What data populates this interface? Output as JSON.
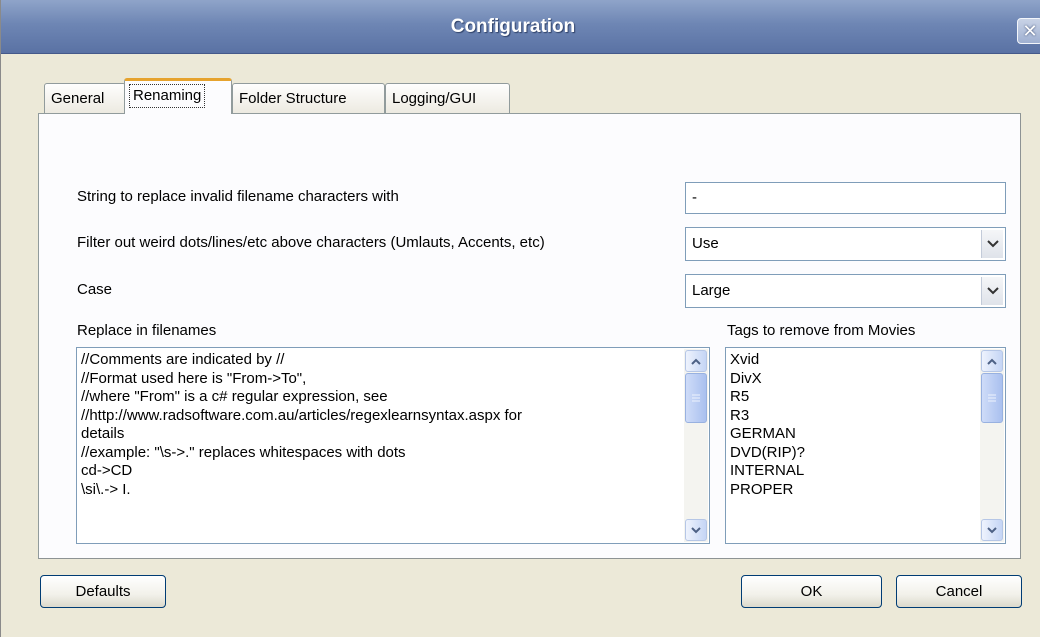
{
  "window": {
    "title": "Configuration",
    "close_glyph": "✕"
  },
  "tabs": [
    {
      "label": "General"
    },
    {
      "label": "Renaming",
      "active": true
    },
    {
      "label": "Folder Structure"
    },
    {
      "label": "Logging/GUI"
    }
  ],
  "renaming": {
    "invalid_chars_label": "String to replace invalid filename characters with",
    "invalid_chars_value": "-",
    "filter_label": "Filter out weird dots/lines/etc above characters (Umlauts, Accents, etc)",
    "filter_value": "Use",
    "case_label": "Case",
    "case_value": "Large",
    "replace_label": "Replace in filenames",
    "replace_lines": [
      "//Comments are indicated by //",
      "//Format used here is \"From->To\",",
      "//where \"From\" is a c# regular expression, see",
      "//http://www.radsoftware.com.au/articles/regexlearnsyntax.aspx for",
      "details",
      "//example: \"\\s->.\" replaces whitespaces with dots",
      "cd->CD",
      "\\si\\.-> I."
    ],
    "tags_label": "Tags to remove from Movies",
    "tags": [
      "Xvid",
      "DivX",
      "R5",
      "R3",
      "GERMAN",
      "DVD(RIP)?",
      "INTERNAL",
      "PROPER"
    ]
  },
  "buttons": {
    "defaults": "Defaults",
    "ok": "OK",
    "cancel": "Cancel"
  },
  "icons": {
    "dropdown": "chevron-down-icon",
    "scroll_up": "chevron-up-icon",
    "scroll_down": "chevron-down-icon",
    "thumb_grip": "grip-icon"
  }
}
